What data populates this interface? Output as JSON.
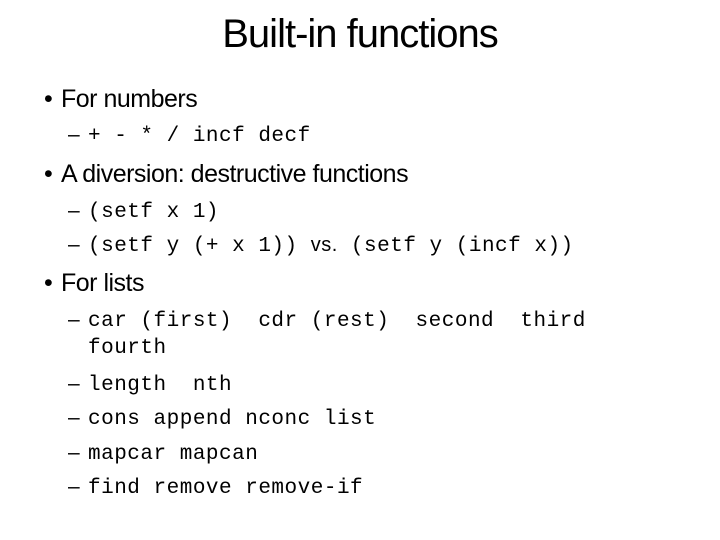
{
  "slide": {
    "title": "Built-in functions",
    "bullet_glyph": "•",
    "dash_glyph": "–",
    "sections": [
      {
        "heading": "For numbers",
        "items": [
          "+ - * / incf decf"
        ]
      },
      {
        "heading": "A diversion: destructive functions",
        "items": [
          "(setf x 1)",
          {
            "left": "(setf y (+ x 1))",
            "connector": "vs.",
            "right": "(setf y (incf x))"
          }
        ]
      },
      {
        "heading": "For lists",
        "items": [
          "car (first)  cdr (rest)  second  third",
          "fourth",
          "length  nth",
          "cons append nconc list",
          "mapcar mapcan",
          "find remove remove-if"
        ]
      }
    ]
  }
}
